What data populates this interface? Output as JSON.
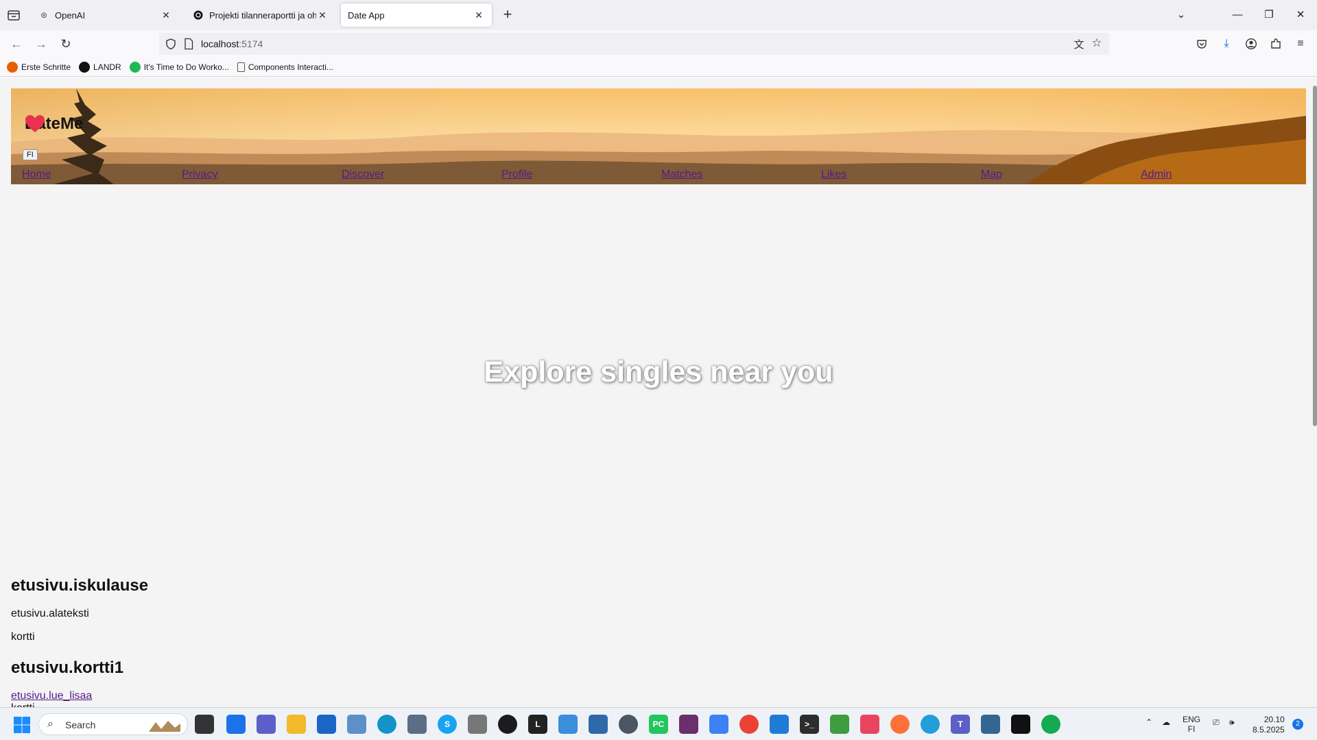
{
  "browser": {
    "tabs": [
      {
        "label": "OpenAI",
        "active": false
      },
      {
        "label": "Projekti tilanneraportti ja ohjeet",
        "active": false
      },
      {
        "label": "Date App",
        "active": true
      }
    ],
    "url_host": "localhost",
    "url_port": ":5174",
    "bookmarks": [
      {
        "label": "Erste Schritte",
        "icon": "firefox-icon",
        "color": "#e66000"
      },
      {
        "label": "LANDR",
        "icon": "landr-icon",
        "color": "#111111"
      },
      {
        "label": "It's Time to Do Worko...",
        "icon": "spotify-icon",
        "color": "#1db954"
      },
      {
        "label": "Components Interacti...",
        "icon": "page-icon",
        "color": "#666666"
      }
    ]
  },
  "app": {
    "brand": "DateMe",
    "lang_button": "FI",
    "nav": [
      "Home",
      "Privacy",
      "Discover",
      "Profile",
      "Matches",
      "Likes",
      "Map",
      "Admin"
    ],
    "hero_title": "Explore singles near you",
    "headline": "etusivu.iskulause",
    "subtext": "etusivu.alateksti",
    "card_label": "kortti",
    "card_title": "etusivu.kortti1",
    "read_more": "etusivu.lue_lisaa",
    "cut_text": "kortti"
  },
  "taskbar": {
    "search_placeholder": "Search",
    "lang_top": "ENG",
    "lang_bottom": "FI",
    "time": "20.10",
    "date": "8.5.2025",
    "notifications": "2"
  },
  "colors": {
    "link_visited": "#551a8b",
    "sky_top": "#f8c978",
    "sky_bottom": "#fde3ac"
  }
}
